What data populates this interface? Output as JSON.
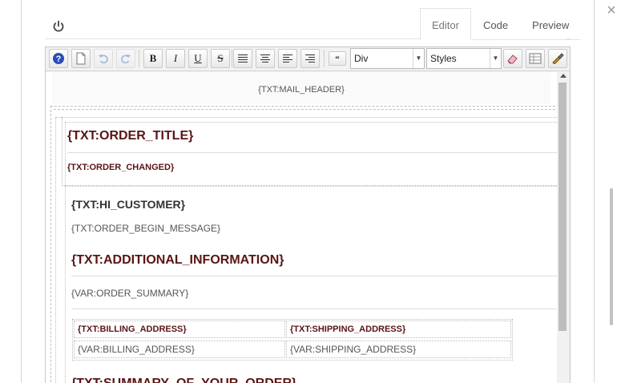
{
  "window": {
    "close_symbol": "×"
  },
  "tabs": [
    {
      "label": "Editor",
      "active": true
    },
    {
      "label": "Code",
      "active": false
    },
    {
      "label": "Preview",
      "active": false
    }
  ],
  "toolbar": {
    "icons": [
      "help-icon",
      "new-page-icon",
      "undo-icon",
      "redo-icon",
      "bold-icon",
      "italic-icon",
      "underline-icon",
      "strikethrough-icon",
      "justify-icon",
      "align-center-icon",
      "align-left-icon",
      "align-right-icon",
      "blockquote-icon",
      "eraser-icon",
      "table-icon",
      "paint-brush-icon"
    ],
    "bold": "B",
    "italic": "I",
    "underline": "U",
    "strike": "S",
    "format_value": "Div",
    "styles_value": "Styles",
    "dropdown_arrow": "▼"
  },
  "content": {
    "mail_header": "{TXT:MAIL_HEADER}",
    "order_title": "{TXT:ORDER_TITLE}",
    "order_changed": "{TXT:ORDER_CHANGED}",
    "hi_customer": "{TXT:HI_CUSTOMER}",
    "order_begin": "{TXT:ORDER_BEGIN_MESSAGE}",
    "additional_info": "{TXT:ADDITIONAL_INFORMATION}",
    "order_summary": "{VAR:ORDER_SUMMARY}",
    "billing_header": "{TXT:BILLING_ADDRESS}",
    "shipping_header": "{TXT:SHIPPING_ADDRESS}",
    "billing_value": "{VAR:BILLING_ADDRESS}",
    "shipping_value": "{VAR:SHIPPING_ADDRESS}",
    "summary_title": "{TXT:SUMMARY_OF_YOUR_ORDER}"
  },
  "colors": {
    "accent_text": "#5a1414",
    "border": "#c8c8c8"
  }
}
